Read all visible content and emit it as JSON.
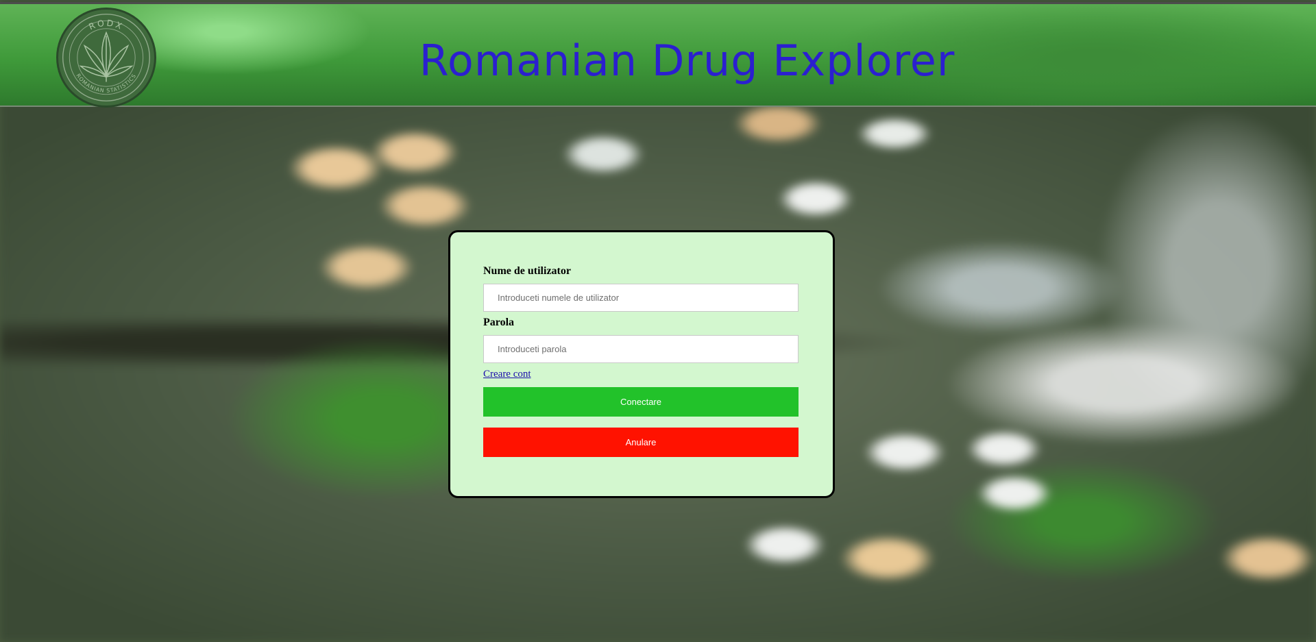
{
  "header": {
    "title": "Romanian Drug Explorer",
    "logo": {
      "top_text": "RODX",
      "bottom_text": "ROMANIAN STATISTICS",
      "icon": "cannabis-leaf-icon"
    }
  },
  "login_form": {
    "username_label": "Nume de utilizator",
    "username_placeholder": "Introduceti numele de utilizator",
    "username_value": "",
    "password_label": "Parola",
    "password_placeholder": "Introduceti parola",
    "password_value": "",
    "create_account_link": "Creare cont",
    "connect_button": "Conectare",
    "cancel_button": "Anulare"
  },
  "colors": {
    "title": "#2b1fd0",
    "card_background": "#d3f7cf",
    "connect_button": "#22c22a",
    "cancel_button": "#ff1200",
    "link": "#1a0dab"
  }
}
